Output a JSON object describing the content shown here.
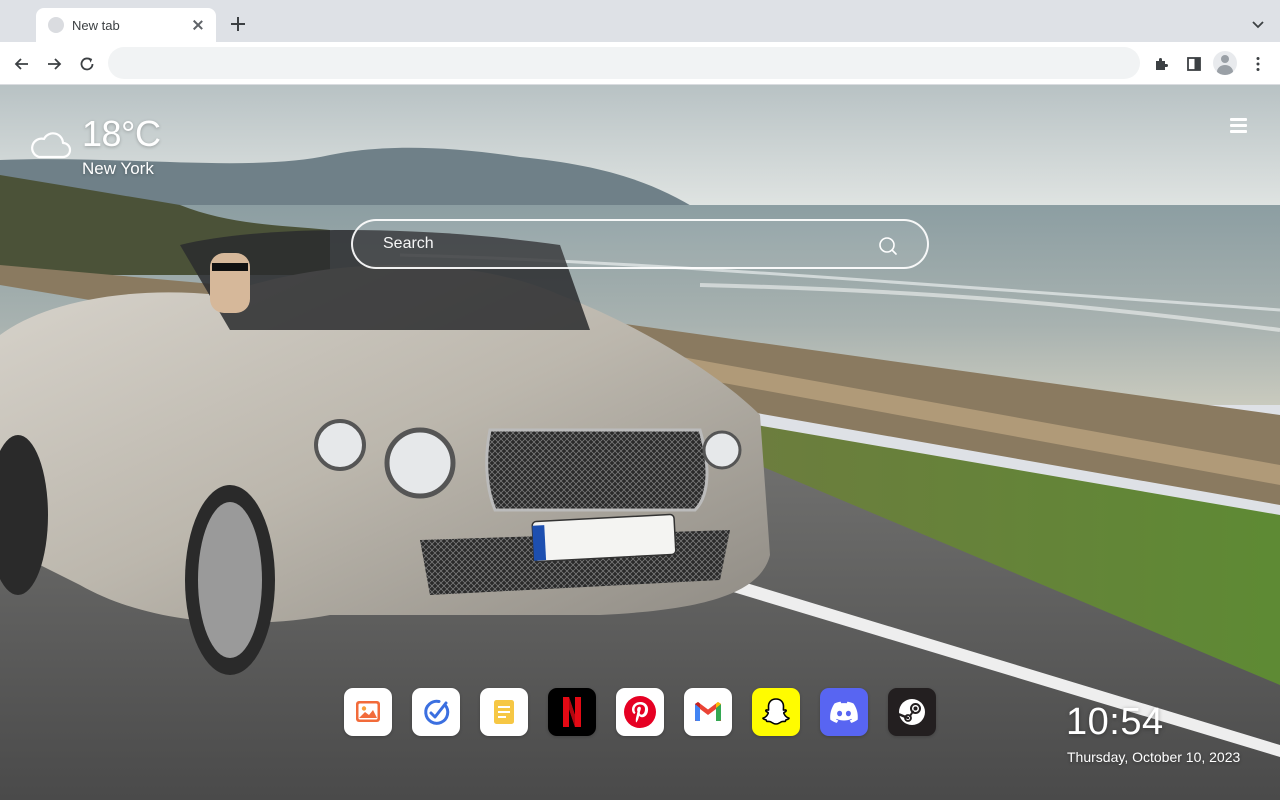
{
  "tab": {
    "title": "New tab"
  },
  "omnibox": {
    "value": ""
  },
  "weather": {
    "temperature": "18°C",
    "city": "New York",
    "icon": "cloud-icon"
  },
  "search": {
    "placeholder": "Search"
  },
  "dock": {
    "apps": [
      {
        "name": "Photos",
        "icon": "photo-icon",
        "color": "#ffffff"
      },
      {
        "name": "Tasks",
        "icon": "check-icon",
        "color": "#ffffff"
      },
      {
        "name": "Notes",
        "icon": "notes-icon",
        "color": "#ffffff"
      },
      {
        "name": "Netflix",
        "icon": "netflix-icon",
        "color": "#000000"
      },
      {
        "name": "Pinterest",
        "icon": "pinterest-icon",
        "color": "#ffffff"
      },
      {
        "name": "Gmail",
        "icon": "gmail-icon",
        "color": "#ffffff"
      },
      {
        "name": "Snapchat",
        "icon": "snapchat-icon",
        "color": "#fffc00"
      },
      {
        "name": "Discord",
        "icon": "discord-icon",
        "color": "#5865f2"
      },
      {
        "name": "Steam",
        "icon": "steam-icon",
        "color": "#231f20"
      }
    ]
  },
  "clock": {
    "time": "10:54",
    "date": "Thursday, October 10, 2023"
  },
  "colors": {
    "accent": "#ffffff",
    "chrome": "#dee1e6"
  }
}
